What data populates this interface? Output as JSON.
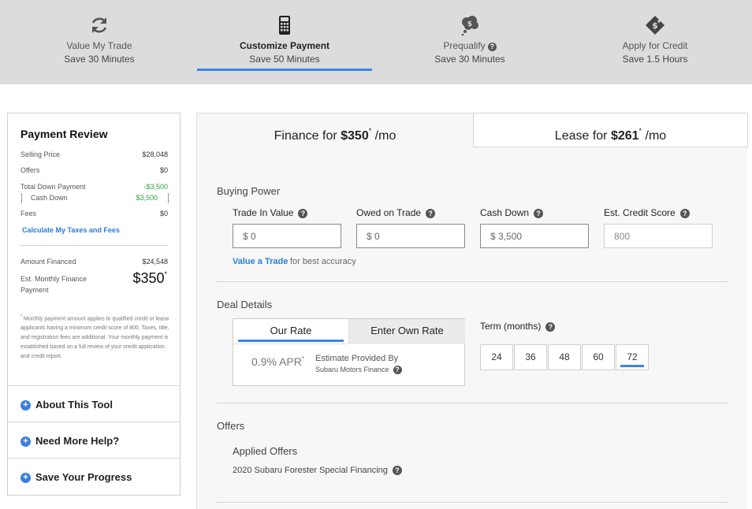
{
  "steps": [
    {
      "title": "Value My Trade",
      "subtitle": "Save 30 Minutes",
      "icon": "refresh-icon"
    },
    {
      "title": "Customize Payment",
      "subtitle": "Save 50 Minutes",
      "icon": "calculator-icon"
    },
    {
      "title": "Prequalify",
      "subtitle": "Save 30 Minutes",
      "icon": "thought-bubble-money-icon"
    },
    {
      "title": "Apply for Credit",
      "subtitle": "Save 1.5 Hours",
      "icon": "tag-money-icon"
    }
  ],
  "active_step": "Customize Payment",
  "sidebar": {
    "title": "Payment Review",
    "rows": [
      {
        "label": "Selling Price",
        "value": "$28,048"
      },
      {
        "label": "Offers",
        "value": "$0"
      },
      {
        "label": "Total Down Payment",
        "value": "-$3,500"
      },
      {
        "label": "Cash Down",
        "value": "$3,500"
      },
      {
        "label": "Fees",
        "value": "$0"
      }
    ],
    "calc_link": "Calculate My Taxes and Fees",
    "amount_financed_label": "Amount Financed",
    "amount_financed": "$24,548",
    "monthly_label_1": "Est. Monthly Finance",
    "monthly_label_2": "Payment",
    "monthly_value": "$350",
    "monthly_sup": "*",
    "note_sup": "*",
    "note": "Monthly payment amount applies to qualified credit or lease applicants having a minimum credit score of 800.  Taxes, title, and registration fees are additional. Your monthly payment is established based on a full review of your credit application and credit report.",
    "accordions": [
      "About This Tool",
      "Need More Help?",
      "Save Your Progress"
    ]
  },
  "tabs": {
    "finance_prefix": "Finance for ",
    "finance_amount": "$350",
    "finance_sup": "*",
    "finance_suffix": " /mo",
    "lease_prefix": "Lease for ",
    "lease_amount": "$261",
    "lease_sup": "*",
    "lease_suffix": " /mo"
  },
  "buying_power": {
    "title": "Buying Power",
    "fields": [
      {
        "label": "Trade In Value",
        "value": "$ 0"
      },
      {
        "label": "Owed on Trade",
        "value": "$ 0"
      },
      {
        "label": "Cash Down",
        "value": "$ 3,500"
      },
      {
        "label": "Est. Credit Score",
        "value": "800"
      }
    ],
    "value_trade_link": "Value a Trade",
    "value_trade_rest": "for best accuracy"
  },
  "deal_details": {
    "title": "Deal Details",
    "rate_tabs": [
      "Our Rate",
      "Enter Own Rate"
    ],
    "apr": "0.9% APR",
    "apr_sup": "*",
    "estimate_line1": "Estimate Provided By",
    "estimate_line2": "Subaru Motors Finance",
    "term_label": "Term (months)",
    "terms": [
      "24",
      "36",
      "48",
      "60",
      "72"
    ],
    "selected_term": "72"
  },
  "offers": {
    "title": "Offers",
    "applied_title": "Applied Offers",
    "applied_item": "2020 Subaru Forester Special Financing"
  },
  "help_mark": "?",
  "plus_mark": "+",
  "colors": {
    "accent": "#3b82f0",
    "link": "#2a7de1",
    "green": "#2e9e3c",
    "header_bg": "#dcdcdc"
  }
}
